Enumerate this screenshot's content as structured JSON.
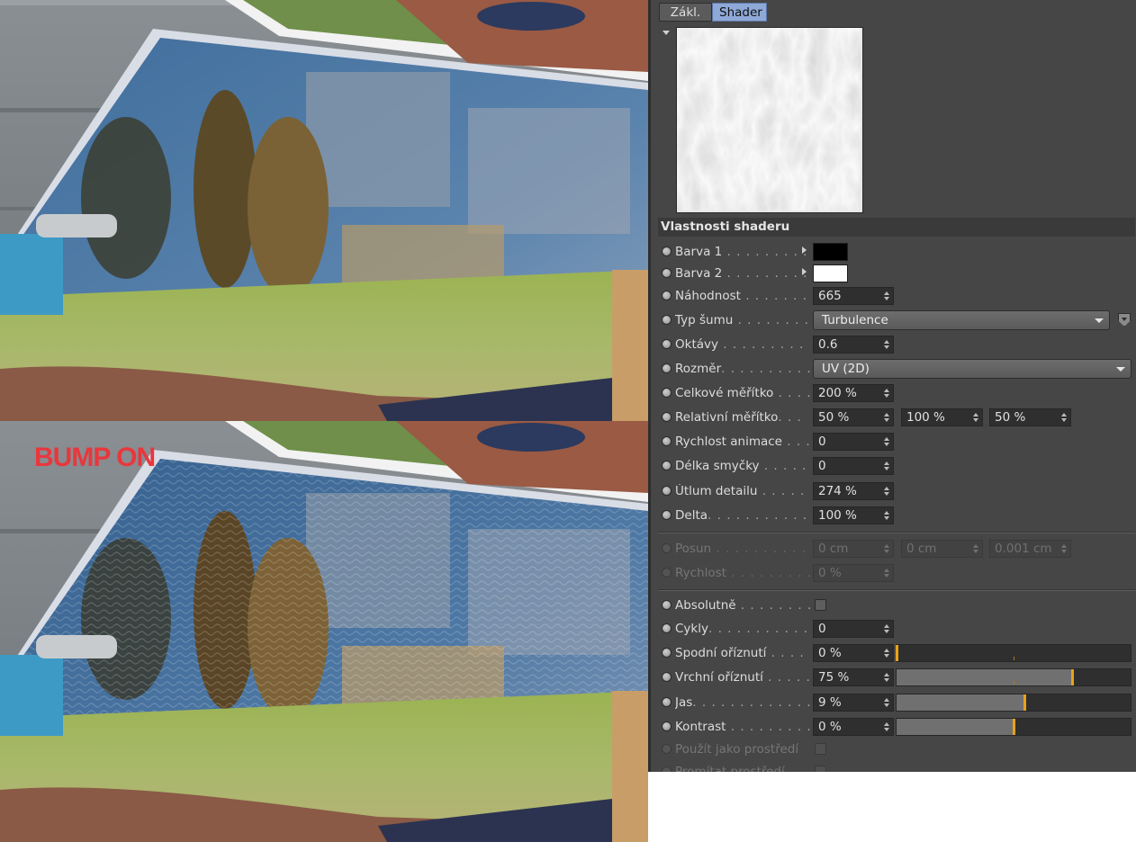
{
  "overlay": {
    "bump_label": "BUMP ON",
    "bump_label_color": "#e8373d"
  },
  "panel": {
    "tabs": [
      {
        "label": "Zákl.",
        "active": false
      },
      {
        "label": "Shader",
        "active": true
      }
    ],
    "section_title": "Vlastnosti shaderu",
    "rows": {
      "barva1": {
        "label": "Barva 1",
        "dots": " . . . . . . . . .",
        "color": "#000000"
      },
      "barva2": {
        "label": "Barva 2",
        "dots": " . . . . . . . . .",
        "color": "#ffffff"
      },
      "nahodnost": {
        "label": "Náhodnost",
        "dots": " . . . . . . . .",
        "value": "665"
      },
      "typ_sumu": {
        "label": "Typ šumu",
        "dots": " . . . . . . . . .",
        "value": "Turbulence"
      },
      "oktavy": {
        "label": "Oktávy",
        "dots": " . . . . . . . . . . .",
        "value": "0.6"
      },
      "rozmer": {
        "label": "Rozměr",
        "dots": ". . . . . . . . . . . .",
        "value": "UV (2D)"
      },
      "celkove_meritko": {
        "label": "Celkové měřítko",
        "dots": " . . . .",
        "value": "200 %"
      },
      "relativni_meritko": {
        "label": "Relativní měřítko",
        "dots": ". . .",
        "values": [
          "50 %",
          "100 %",
          "50 %"
        ]
      },
      "rychlost_animace": {
        "label": "Rychlost animace",
        "dots": " . . .",
        "value": "0"
      },
      "delka_smycky": {
        "label": "Délka smyčky",
        "dots": " . . . . . .",
        "value": "0"
      },
      "utlum_detailu": {
        "label": "Útlum detailu",
        "dots": " . . . . .",
        "value": "274 %"
      },
      "delta": {
        "label": "Delta",
        "dots": ". . . . . . . . . . . . .",
        "value": "100 %"
      },
      "posun": {
        "label": "Posun",
        "dots": " . . . . . . . . . . . .",
        "values": [
          "0 cm",
          "0 cm",
          "0.001 cm"
        ]
      },
      "rychlost": {
        "label": "Rychlost",
        "dots": " . . . . . . . . . . .",
        "value": "0 %"
      },
      "absolutne": {
        "label": "Absolutně",
        "dots": " . . . . . . . . .",
        "checked": false
      },
      "cykly": {
        "label": "Cykly",
        "dots": ". . . . . . . . . . . . .",
        "value": "0"
      },
      "spodni_oriznuti": {
        "label": "Spodní oříznutí",
        "dots": " . . . . .",
        "value": "0 %",
        "level": 0.0
      },
      "vrchni_oriznuti": {
        "label": "Vrchní oříznutí",
        "dots": " . . . . .",
        "value": "75 %",
        "level": 0.75
      },
      "jas": {
        "label": "Jas",
        "dots": ". . . . . . . . . . . . . . .",
        "value": "9 %",
        "level": 0.09
      },
      "kontrast": {
        "label": "Kontrast",
        "dots": " . . . . . . . . . .",
        "value": "0 %",
        "level": 0.0
      },
      "pouzit_jako_prostredi": {
        "label": "Použít jako prostředí",
        "checked": false
      },
      "promitat_prostredi": {
        "label": "Promítat prostředí",
        "checked": false
      }
    }
  },
  "colors": {
    "panel_bg": "#464646",
    "active_tab": "#8ea9d8",
    "slider_marker": "#e8a21a"
  }
}
